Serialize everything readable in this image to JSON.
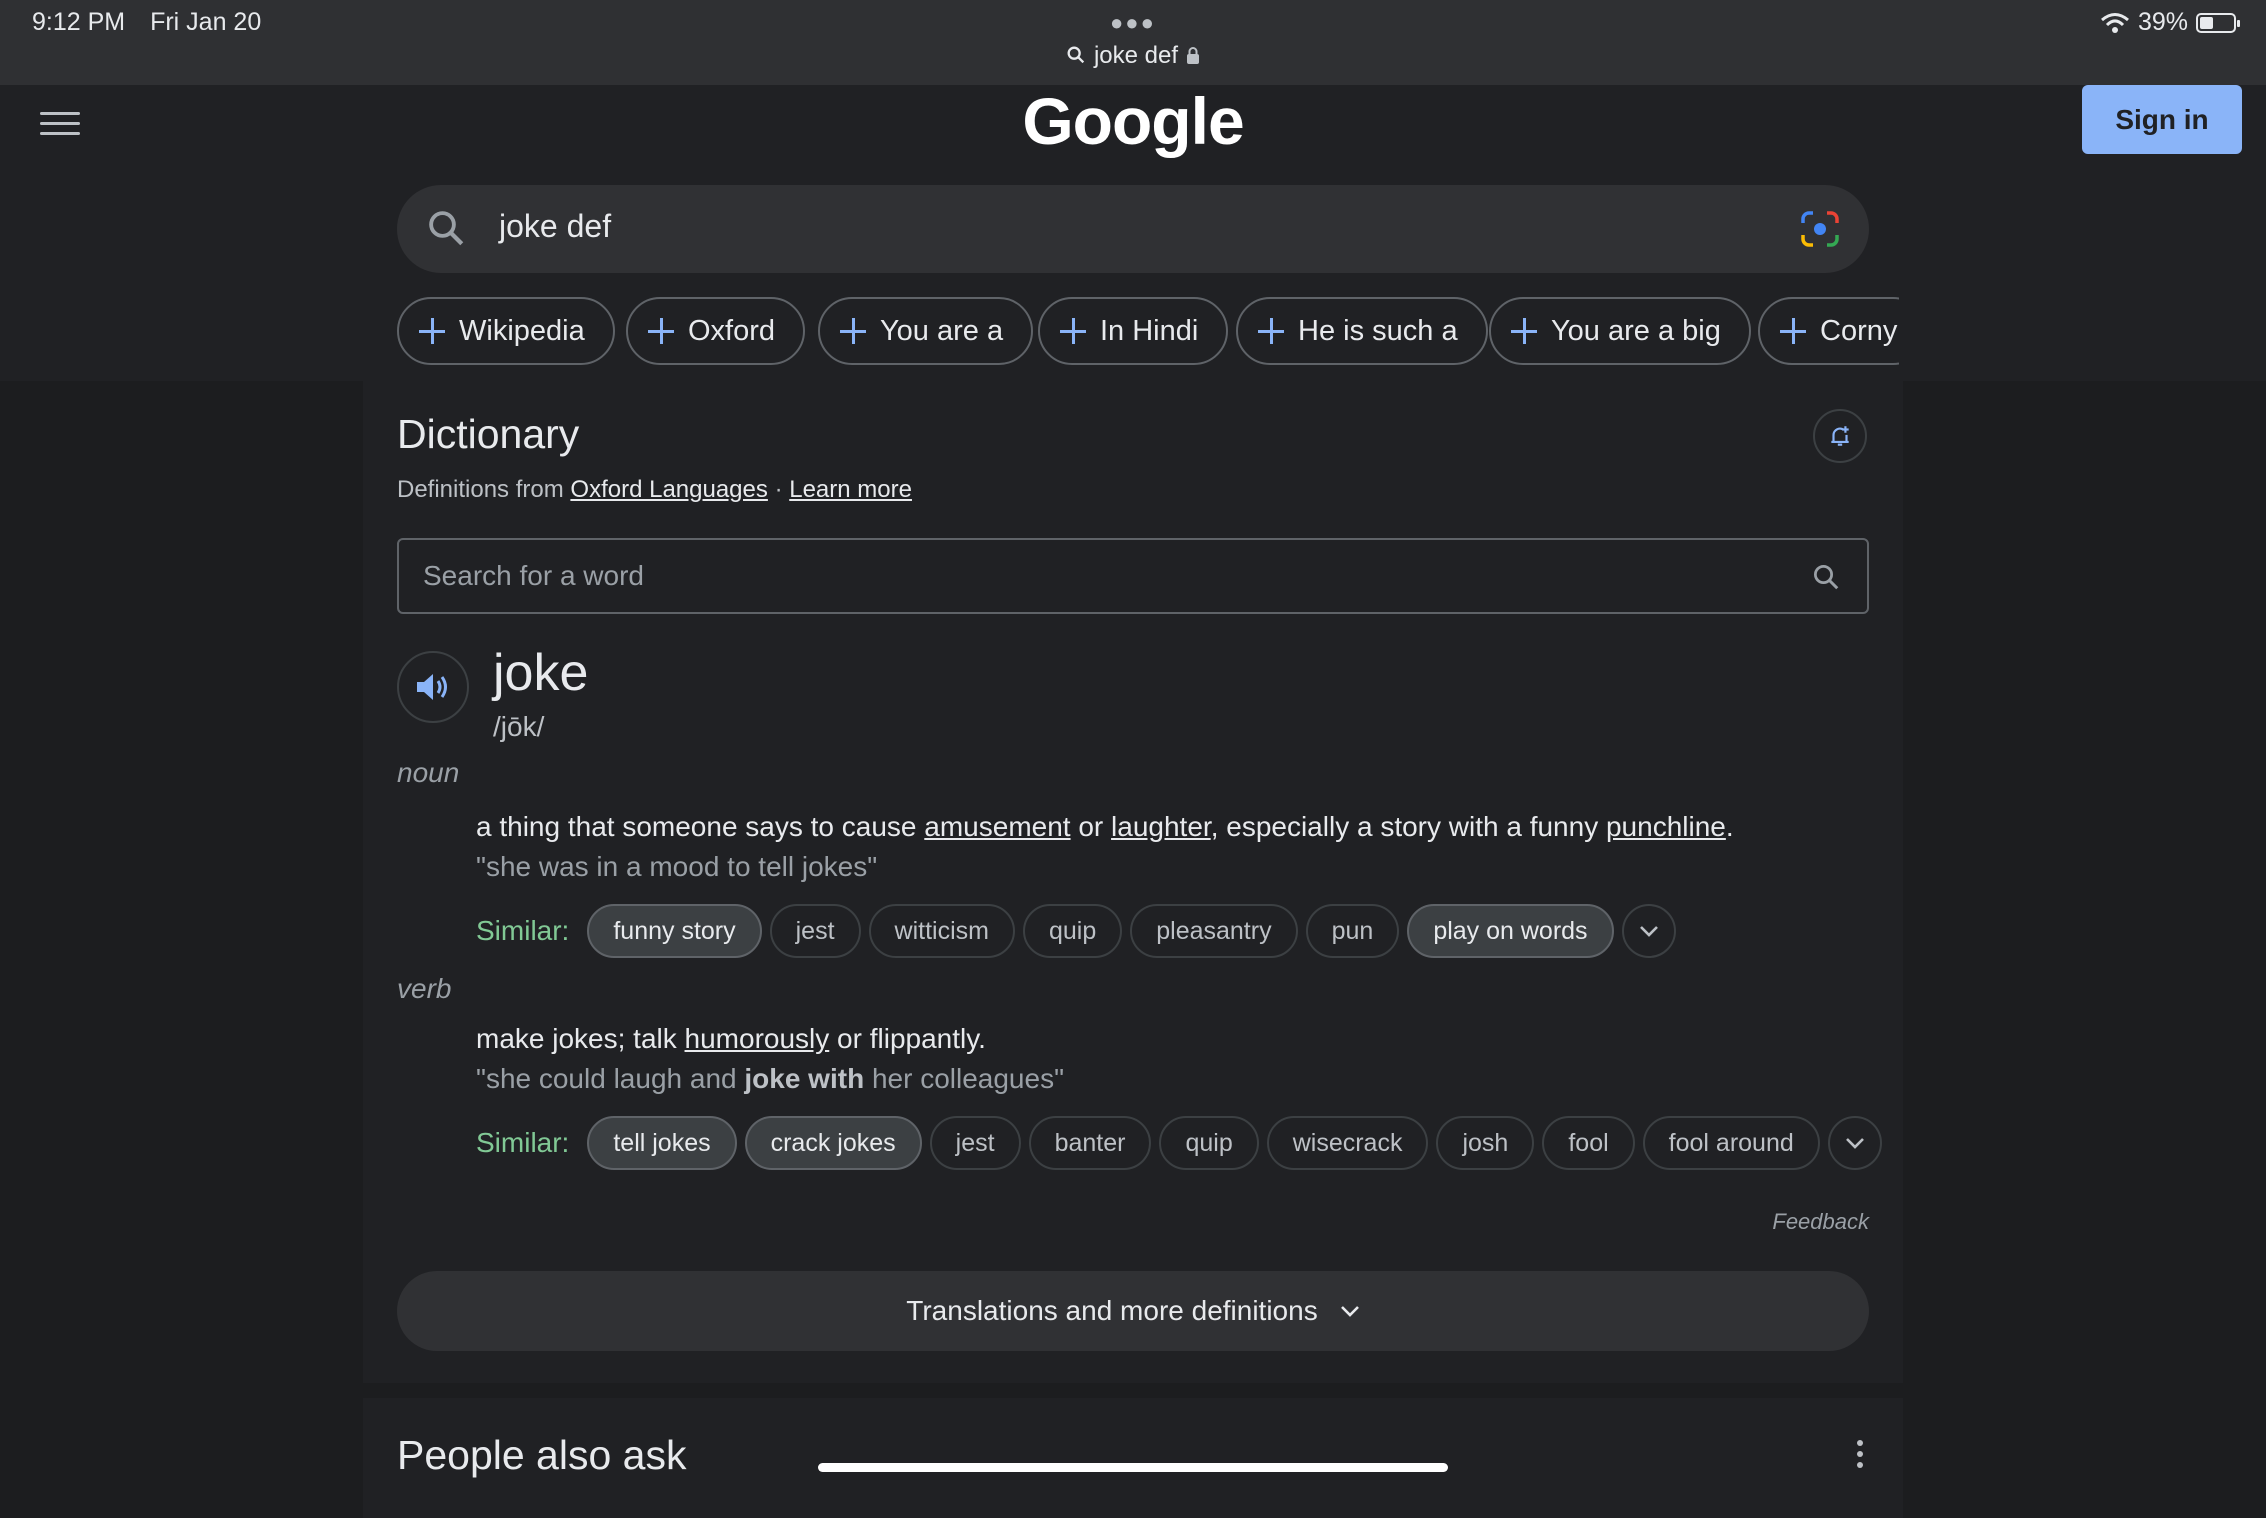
{
  "status_bar": {
    "time": "9:12 PM",
    "date": "Fri Jan 20",
    "battery": "39%",
    "battery_level": 0.39
  },
  "address_bar": {
    "text": "joke def"
  },
  "header": {
    "logo": "Google",
    "sign_in": "Sign in"
  },
  "search": {
    "query": "joke def"
  },
  "chips": [
    "Wikipedia",
    "Oxford",
    "You are a",
    "In Hindi",
    "He is such a",
    "You are a big",
    "Corny"
  ],
  "dictionary": {
    "title": "Dictionary",
    "source_prefix": "Definitions from",
    "source_link": "Oxford Languages",
    "separator": "·",
    "learn_more": "Learn more",
    "search_placeholder": "Search for a word",
    "word": "joke",
    "phonetic": "/jōk/",
    "noun": {
      "pos": "noun",
      "def_parts": [
        "a thing that someone says to cause ",
        "amusement",
        " or ",
        "laughter",
        ", especially a story with a funny ",
        "punchline",
        "."
      ],
      "example": "\"she was in a mood to tell jokes\"",
      "similar_label": "Similar:",
      "similar": [
        "funny story",
        "jest",
        "witticism",
        "quip",
        "pleasantry",
        "pun",
        "play on words"
      ]
    },
    "verb": {
      "pos": "verb",
      "def_parts": [
        "make jokes; talk ",
        "humorously",
        " or flippantly."
      ],
      "example_parts": [
        "\"she could laugh and ",
        "joke with",
        " her colleagues\""
      ],
      "similar_label": "Similar:",
      "similar": [
        "tell jokes",
        "crack jokes",
        "jest",
        "banter",
        "quip",
        "wisecrack",
        "josh",
        "fool",
        "fool around"
      ]
    },
    "feedback": "Feedback",
    "translations": "Translations and more definitions"
  },
  "people_also_ask": {
    "title": "People also ask"
  },
  "colors": {
    "accent": "#8ab4f8",
    "similar_label": "#81c995",
    "background": "#202124"
  }
}
